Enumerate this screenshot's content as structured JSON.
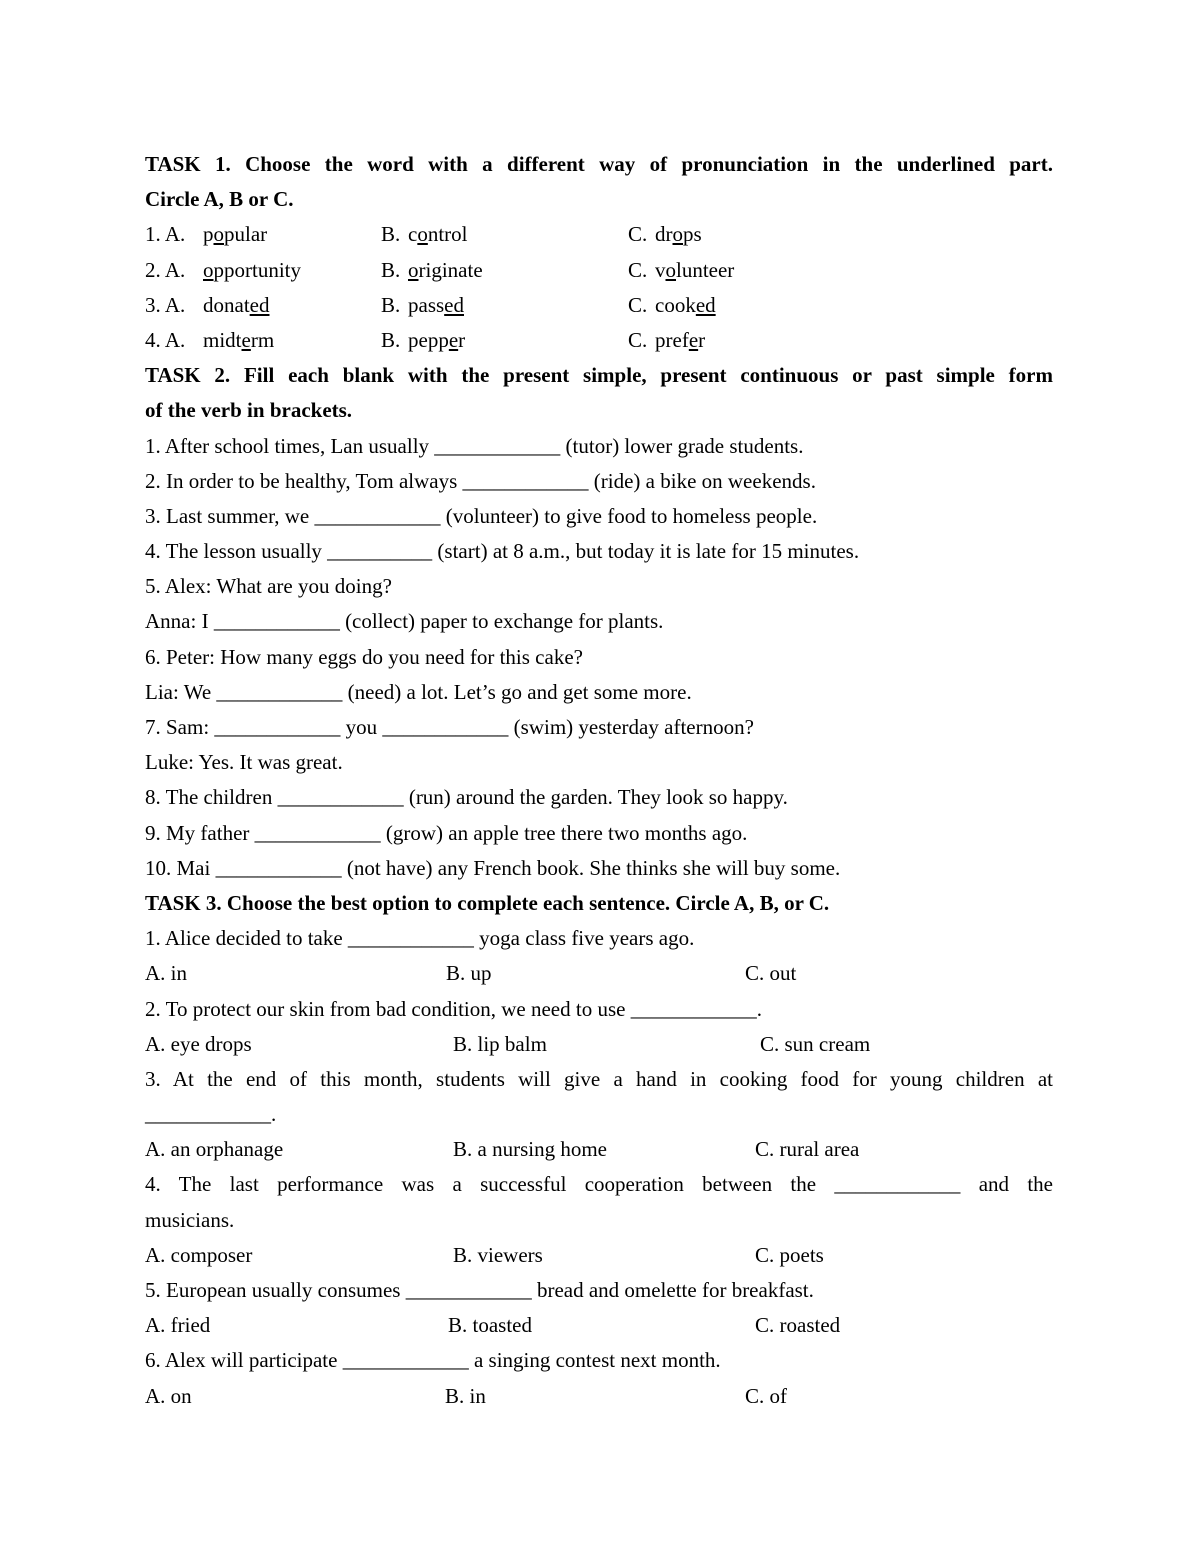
{
  "task1": {
    "heading_line1": "TASK 1. Choose the word with a different way of pronunciation in the underlined part.",
    "heading_line2": "Circle A, B or C.",
    "items": [
      {
        "num": "1. A.",
        "options": [
          {
            "label": "",
            "pre": "p",
            "u": "o",
            "post": "pular"
          },
          {
            "label": "B.",
            "pre": "c",
            "u": "o",
            "post": "ntrol"
          },
          {
            "label": "C.",
            "pre": "dr",
            "u": "o",
            "post": "ps"
          }
        ]
      },
      {
        "num": "2. A.",
        "options": [
          {
            "label": "",
            "pre": "",
            "u": "o",
            "post": "pportunity"
          },
          {
            "label": "B.",
            "pre": "",
            "u": "o",
            "post": "riginate"
          },
          {
            "label": "C.",
            "pre": "v",
            "u": "o",
            "post": "lunteer"
          }
        ]
      },
      {
        "num": "3. A.",
        "options": [
          {
            "label": "",
            "pre": "donat",
            "u": "ed",
            "post": ""
          },
          {
            "label": "B.",
            "pre": "pass",
            "u": "ed",
            "post": ""
          },
          {
            "label": "C.",
            "pre": "cook",
            "u": "ed",
            "post": ""
          }
        ]
      },
      {
        "num": "4. A.",
        "options": [
          {
            "label": "",
            "pre": "midt",
            "u": "e",
            "post": "rm"
          },
          {
            "label": "B.",
            "pre": "pepp",
            "u": "e",
            "post": "r"
          },
          {
            "label": "C.",
            "pre": "pref",
            "u": "e",
            "post": "r"
          }
        ]
      }
    ]
  },
  "task2": {
    "heading_line1": "TASK 2. Fill each blank with the present simple, present continuous or past simple form",
    "heading_line2": "of the verb in brackets.",
    "lines": [
      "1. After school times, Lan usually ____________ (tutor) lower grade students.",
      "2. In order to be healthy, Tom always ____________ (ride) a bike on weekends.",
      "3. Last summer, we ____________ (volunteer) to give food to homeless people.",
      "4. The lesson usually __________ (start) at 8 a.m., but today it is late for 15 minutes.",
      "5. Alex: What are you doing?",
      "Anna: I ____________ (collect) paper to exchange for plants.",
      "6. Peter: How many eggs do you need for this cake?",
      "Lia: We ____________ (need) a lot. Let’s go and get some more.",
      "7. Sam: ____________ you ____________ (swim) yesterday afternoon?",
      "Luke: Yes. It was great.",
      "8. The children ____________ (run) around the garden. They look so happy.",
      "9. My father ____________ (grow) an apple tree there two months ago.",
      "10. Mai ____________ (not have) any French book. She thinks she will buy some."
    ]
  },
  "task3": {
    "heading": "TASK 3. Choose the best option to complete each sentence. Circle A, B, or C.",
    "questions": [
      {
        "q": [
          "1. Alice decided to take ____________ yoga class five years ago."
        ],
        "options": [
          "A. in",
          "B. up",
          "C. out"
        ]
      },
      {
        "q": [
          "2. To protect our skin from bad condition, we need to use ____________."
        ],
        "options": [
          "A. eye drops",
          "B. lip balm",
          "C. sun cream"
        ]
      },
      {
        "q": [
          "3. At the end of this month, students will give a hand in cooking food for young children at",
          "____________."
        ],
        "options": [
          "A. an orphanage",
          "B. a nursing home",
          "C. rural area"
        ]
      },
      {
        "q": [
          "4. The last performance was a successful cooperation between the ____________ and the",
          "musicians."
        ],
        "options": [
          "A. composer",
          "B. viewers",
          "C. poets"
        ]
      },
      {
        "q": [
          "5. European usually consumes ____________ bread and omelette for breakfast."
        ],
        "options": [
          "A. fried",
          "B. toasted",
          "C. roasted"
        ]
      },
      {
        "q": [
          "6. Alex will participate ____________ a singing contest next month."
        ],
        "options": [
          "A. on",
          "B. in",
          "C. of"
        ]
      }
    ]
  }
}
